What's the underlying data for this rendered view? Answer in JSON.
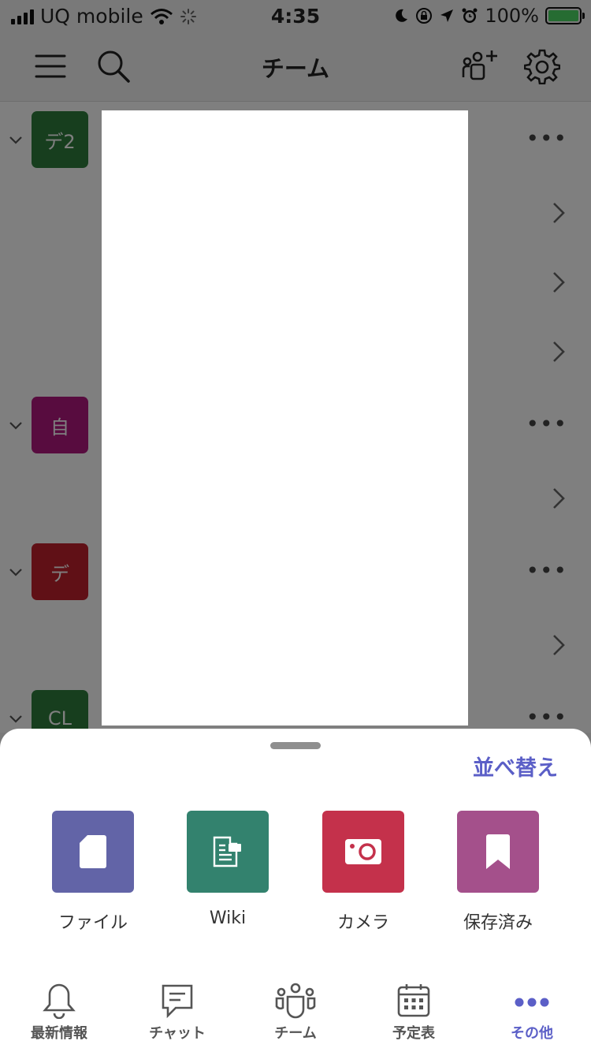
{
  "status_bar": {
    "carrier": "UQ mobile",
    "time": "4:35",
    "battery": "100%"
  },
  "header": {
    "title": "チーム"
  },
  "teams": [
    {
      "avatar_text": "デ2",
      "avatar_color": "#2f7d3c"
    },
    {
      "avatar_text": "自",
      "avatar_color": "#b0197e"
    },
    {
      "avatar_text": "デ",
      "avatar_color": "#c1202c"
    },
    {
      "avatar_text": "CL",
      "avatar_color": "#2f7d3c"
    }
  ],
  "sheet": {
    "sort_label": "並べ替え",
    "tiles": [
      {
        "label": "ファイル",
        "icon": "file-icon",
        "color": "#6264a7"
      },
      {
        "label": "Wiki",
        "icon": "wiki-icon",
        "color": "#33826e"
      },
      {
        "label": "カメラ",
        "icon": "camera-icon",
        "color": "#c4314b"
      },
      {
        "label": "保存済み",
        "icon": "bookmark-icon",
        "color": "#a4508b"
      }
    ]
  },
  "tabbar": {
    "tabs": [
      {
        "label": "最新情報",
        "icon": "bell-icon",
        "active": false
      },
      {
        "label": "チャット",
        "icon": "chat-icon",
        "active": false
      },
      {
        "label": "チーム",
        "icon": "teams-icon",
        "active": false
      },
      {
        "label": "予定表",
        "icon": "calendar-icon",
        "active": false
      },
      {
        "label": "その他",
        "icon": "more-icon",
        "active": true
      }
    ]
  }
}
